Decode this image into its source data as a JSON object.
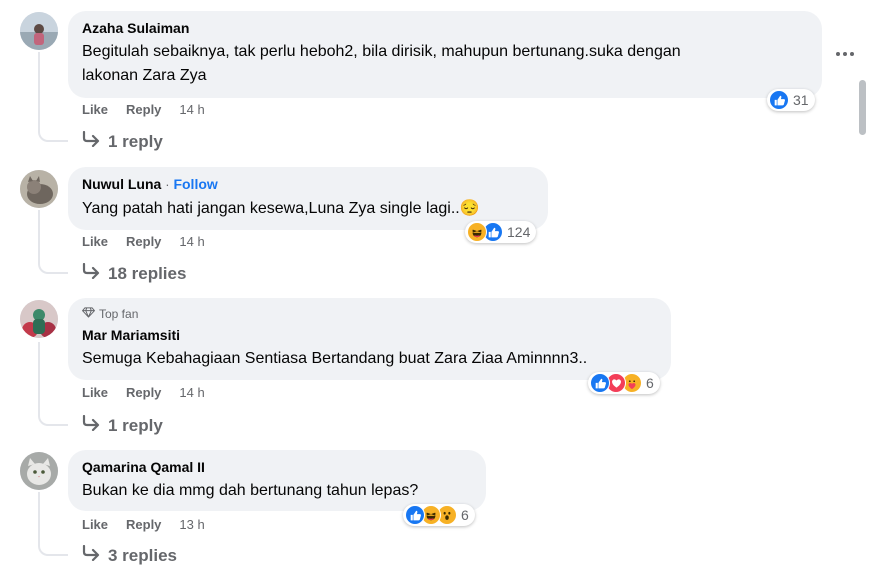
{
  "actions": {
    "like": "Like",
    "reply": "Reply"
  },
  "comments": [
    {
      "author": "Azaha Sulaiman",
      "text_lines": [
        "Begitulah sebaiknya, tak perlu heboh2, bila dirisik, mahupun bertunang.suka dengan",
        "lakonan Zara Zya"
      ],
      "time": "14 h",
      "reaction_icons": [
        "like-icon"
      ],
      "reaction_count": "31",
      "replies": "1 reply"
    },
    {
      "author": "Nuwul Luna",
      "follow_sep": "·",
      "follow": "Follow",
      "text_lines": [
        "Yang patah hati jangan kesewa,Luna Zya single lagi..😔"
      ],
      "time": "14 h",
      "reaction_icons": [
        "haha-icon",
        "like-icon"
      ],
      "reaction_count": "124",
      "replies": "18 replies"
    },
    {
      "badge": "Top fan",
      "author": "Mar Mariamsiti",
      "text_lines": [
        "Semuga Kebahagiaan Sentiasa Bertandang buat Zara Ziaa Aminnnn3.."
      ],
      "time": "14 h",
      "reaction_icons": [
        "like-icon",
        "love-icon",
        "care-icon"
      ],
      "reaction_count": "6",
      "replies": "1 reply"
    },
    {
      "author": "Qamarina Qamal II",
      "text_lines": [
        "Bukan ke dia mmg dah bertunang tahun lepas?"
      ],
      "time": "13 h",
      "reaction_icons": [
        "like-icon",
        "haha-icon",
        "wow-icon"
      ],
      "reaction_count": "6",
      "replies": "3 replies"
    }
  ],
  "colors": {
    "like": "#1877f2",
    "love": "#f33e58",
    "haha": "#f7b125",
    "bubble": "#f0f2f5",
    "follow": "#1877f2"
  }
}
